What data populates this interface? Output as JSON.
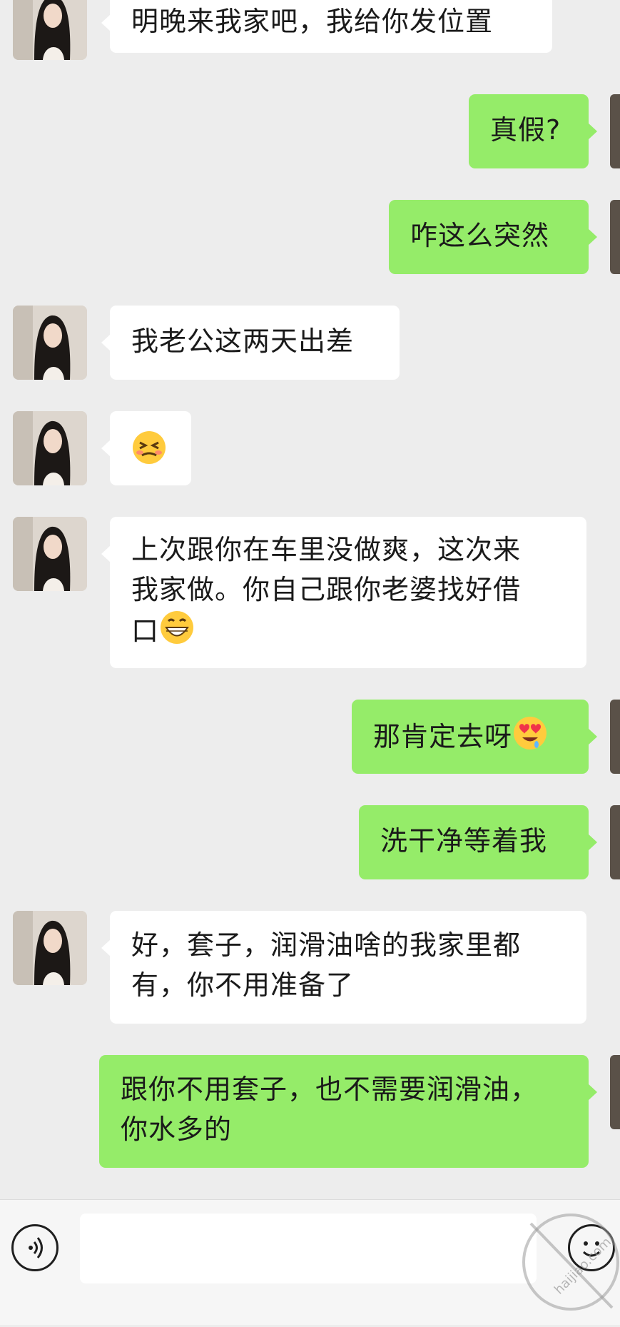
{
  "messages": [
    {
      "side": "in",
      "text": "明晚来我家吧，我给你发位置"
    },
    {
      "side": "out",
      "text": "真假?"
    },
    {
      "side": "out",
      "text": "咋这么突然"
    },
    {
      "side": "in",
      "text": "我老公这两天出差"
    },
    {
      "side": "in",
      "emoji": "persevering-face-emoji"
    },
    {
      "side": "in",
      "line1": "上次跟你在车里没做爽，这次来",
      "line2": "我家做。你自己跟你老婆找好借",
      "line3": "口",
      "emoji": "grinning-face-emoji"
    },
    {
      "side": "out",
      "text": "那肯定去呀",
      "emoji": "heart-eyes-drooling-emoji"
    },
    {
      "side": "out",
      "text": "洗干净等着我"
    },
    {
      "side": "in",
      "line1": "好，套子，润滑油啥的我家里都",
      "line2": "有，你不用准备了"
    },
    {
      "side": "out",
      "line1": "跟你不用套子，也不需要润滑油，",
      "line2": "你水多的"
    }
  ],
  "input_bar": {
    "placeholder": "",
    "voice_icon": "voice-icon",
    "emoji_icon": "emoji-smiley-icon"
  },
  "watermark": {
    "text": "海角社区 haijiao.com"
  },
  "colors": {
    "background": "#ededed",
    "incoming": "#ffffff",
    "outgoing": "#95ec69"
  }
}
